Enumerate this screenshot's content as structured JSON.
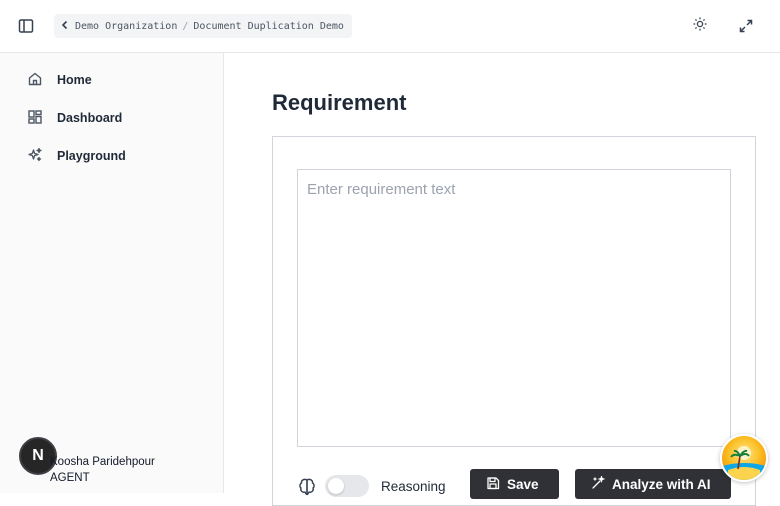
{
  "breadcrumb": {
    "organization": "Demo Organization",
    "separator": "/",
    "document": "Document Duplication Demo"
  },
  "sidebar": {
    "items": [
      {
        "label": "Home",
        "icon": "home-icon"
      },
      {
        "label": "Dashboard",
        "icon": "dashboard-icon"
      },
      {
        "label": "Playground",
        "icon": "sparkles-icon"
      }
    ],
    "user": {
      "avatar_letter": "N",
      "name": "Koosha Paridehpour",
      "role": "AGENT"
    }
  },
  "main": {
    "title": "Requirement",
    "requirement_input": {
      "value": "",
      "placeholder": "Enter requirement text"
    },
    "reasoning": {
      "label": "Reasoning",
      "enabled": false
    },
    "save_label": "Save",
    "analyze_label": "Analyze with AI"
  },
  "colors": {
    "button_bg": "#2f3136",
    "sidebar_bg": "#fafafa",
    "border": "#e5e7eb"
  }
}
